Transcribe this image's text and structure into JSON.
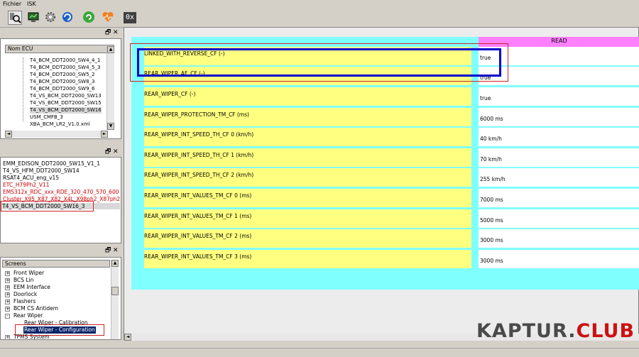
{
  "menu": {
    "file": "Fichier",
    "isk": "ISK"
  },
  "toolbar": {
    "zero_x": "0x"
  },
  "panel_buttons": {
    "restore": "🗗",
    "close": "✕"
  },
  "ecu_tree": {
    "header": "Nom ECU",
    "items": [
      "T4_BCM_DDT2000_SW4_4_1",
      "T4_BCM_DDT2000_SW4_5_3",
      "T4_BCM_DDT2000_SW5_2",
      "T4_BCM_DDT2000_SW8_3",
      "T4_BCM_DDT2000_SW9_6",
      "T4_VS_BCM_DDT2000_SW13",
      "T4_VS_BCM_DDT2000_SW15",
      "T4_VS_BCM_DDT2000_SW16",
      "USM_CMFB_3",
      "XBA_BCM_LR2_V1.0.xml"
    ]
  },
  "ecu_list": {
    "items": [
      {
        "text": "EMM_EDISON_DDT2000_SW15_V1_1",
        "color": "#000000"
      },
      {
        "text": "T4_VS_HFM_DDT2000_SW14",
        "color": "#000000"
      },
      {
        "text": "RSAT4_ACU_eng_v15",
        "color": "#000000"
      },
      {
        "text": "ETC_H79Ph2_V11",
        "color": "#cc0000"
      },
      {
        "text": "EMS312x_RDC_xxx_RDE_320_470_570_600",
        "color": "#cc0000"
      },
      {
        "text": "Cluster_X95_X87_X82_X4L_X98ph2_X87ph2",
        "color": "#cc0000"
      },
      {
        "text": "T4_VS_BCM_DDT2000_SW16_3",
        "color": "#000000"
      }
    ]
  },
  "screens": {
    "header": "Screens",
    "items": [
      {
        "text": "Front Wiper",
        "expander": "+"
      },
      {
        "text": "BCS Lin",
        "expander": "+"
      },
      {
        "text": "EEM Interface",
        "expander": "+"
      },
      {
        "text": "Doorlock",
        "expander": "+"
      },
      {
        "text": "Flashers",
        "expander": "+"
      },
      {
        "text": "BCM CS Antidem",
        "expander": "+"
      },
      {
        "text": "Rear Wiper",
        "expander": "-"
      },
      {
        "text": "Rear Wiper - Calibration",
        "expander": ""
      },
      {
        "text": "Rear Wiper - Configuration",
        "expander": ""
      },
      {
        "text": "TPMS System",
        "expander": "+"
      }
    ]
  },
  "main": {
    "read_header": "READ",
    "rows": [
      {
        "label": "LINKED_WITH_REVERSE_CF (-)",
        "value": "true"
      },
      {
        "label": "REAR_WIPER_AF_CF (-)",
        "value": "true"
      },
      {
        "label": "REAR_WIPER_CF (-)",
        "value": "true"
      },
      {
        "label": "REAR_WIPER_PROTECTION_TM_CF (ms)",
        "value": "6000 ms"
      },
      {
        "label": "REAR_WIPER_INT_SPEED_TH_CF 0 (km/h)",
        "value": "40 km/h"
      },
      {
        "label": "REAR_WIPER_INT_SPEED_TH_CF 1 (km/h)",
        "value": "70 km/h"
      },
      {
        "label": "REAR_WIPER_INT_SPEED_TH_CF 2 (km/h)",
        "value": "255 km/h"
      },
      {
        "label": "REAR_WIPER_INT_VALUES_TM_CF 0 (ms)",
        "value": "7000 ms"
      },
      {
        "label": "REAR_WIPER_INT_VALUES_TM_CF 1 (ms)",
        "value": "5000 ms"
      },
      {
        "label": "REAR_WIPER_INT_VALUES_TM_CF 2 (ms)",
        "value": "3000 ms"
      },
      {
        "label": "REAR_WIPER_INT_VALUES_TM_CF 3 (ms)",
        "value": "3000 ms"
      }
    ]
  },
  "watermark": {
    "part1": "KAPTUR.",
    "part2": "CLUB"
  },
  "colors": {
    "cyan_bg": "#80ffff",
    "label_bg": "#ffff80",
    "read_header_bg": "#ff80ff",
    "highlight_red": "#cc2222",
    "highlight_blue": "#0000cc"
  }
}
